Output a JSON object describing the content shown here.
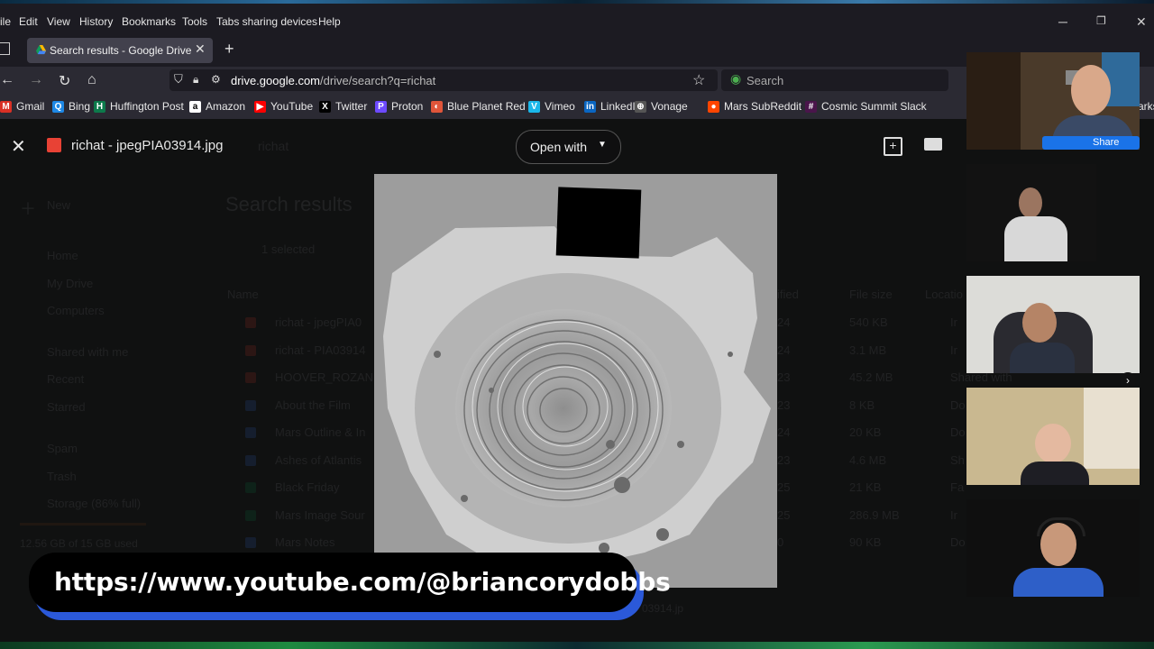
{
  "menu": {
    "items": [
      "ile",
      "Edit",
      "View",
      "History",
      "Bookmarks",
      "Tools",
      "Tabs sharing devices",
      "Help"
    ]
  },
  "tab": {
    "title": "Search results - Google Drive",
    "close": "✕",
    "new": "+"
  },
  "nav": {
    "url_host": "drive.google.com",
    "url_path": "/drive/search?q=richat",
    "search_placeholder": "Search"
  },
  "bookmarks": [
    {
      "label": "Gmail",
      "color": "#d93025",
      "glyph": "M"
    },
    {
      "label": "Bing",
      "color": "#1e88e5",
      "glyph": "Q"
    },
    {
      "label": "Huffington Post",
      "color": "#0d7a4b",
      "glyph": "H"
    },
    {
      "label": "Amazon",
      "color": "#ffffff",
      "glyph": "a"
    },
    {
      "label": "YouTube",
      "color": "#ff0000",
      "glyph": "▶"
    },
    {
      "label": "Twitter",
      "color": "#000000",
      "glyph": "X"
    },
    {
      "label": "Proton",
      "color": "#6d4aff",
      "glyph": "P"
    },
    {
      "label": "Blue Planet Red",
      "color": "#e0553a",
      "glyph": "◐"
    },
    {
      "label": "Vimeo",
      "color": "#1ab7ea",
      "glyph": "V"
    },
    {
      "label": "LinkedIn",
      "color": "#0a66c2",
      "glyph": "in"
    },
    {
      "label": "Vonage",
      "color": "#555555",
      "glyph": "⊕"
    },
    {
      "label": "Mars SubReddit",
      "color": "#ff4500",
      "glyph": "●"
    },
    {
      "label": "Cosmic Summit Slack",
      "color": "#4a154b",
      "glyph": "#"
    }
  ],
  "bookmarks_overflow": "arks",
  "viewer": {
    "filename": "richat - jpegPIA03914.jpg",
    "open_with": "Open with",
    "close": "✕"
  },
  "drive_bg": {
    "search_query": "richat",
    "heading": "Search results",
    "selected": "1 selected",
    "new": "New",
    "nav": [
      "Home",
      "My Drive",
      "Computers",
      "Shared with me",
      "Recent",
      "Starred",
      "Spam",
      "Trash",
      "Storage (86% full)"
    ],
    "storage_used": "12.56 GB of 15 GB used",
    "col_name": "Name",
    "col_modified": "ified",
    "col_size": "File size",
    "col_location": "Locatio",
    "files": [
      {
        "name": "richat - jpegPIA0",
        "size": "540 KB",
        "date": "24",
        "loc": "Ir"
      },
      {
        "name": "richat - PIA03914",
        "size": "3.1 MB",
        "date": "24",
        "loc": "Ir"
      },
      {
        "name": "HOOVER_ROZAN",
        "size": "45.2 MB",
        "date": "23",
        "loc": "Shared with"
      },
      {
        "name": "About the Film",
        "size": "8 KB",
        "date": "23",
        "loc": "Do"
      },
      {
        "name": "Mars Outline & In",
        "size": "20 KB",
        "date": "24",
        "loc": "Do"
      },
      {
        "name": "Ashes of Atlantis",
        "size": "4.6 MB",
        "date": "23",
        "loc": "Sh"
      },
      {
        "name": "Black Friday",
        "size": "21 KB",
        "date": "25",
        "loc": "Fa"
      },
      {
        "name": "Mars Image Sour",
        "size": "286.9 MB",
        "date": "25",
        "loc": "Ir"
      },
      {
        "name": "Mars Notes",
        "size": "90 KB",
        "date": "0",
        "loc": "Do"
      }
    ],
    "footer_name": "03914.jp"
  },
  "share_label": "Share",
  "youtube_url": "https://www.youtube.com/@briancorydobbs",
  "colors": {
    "accent_blue": "#2b59d9",
    "drive_red": "#e84235",
    "toolbar": "#2b2a33",
    "tabbar": "#1c1b22"
  }
}
